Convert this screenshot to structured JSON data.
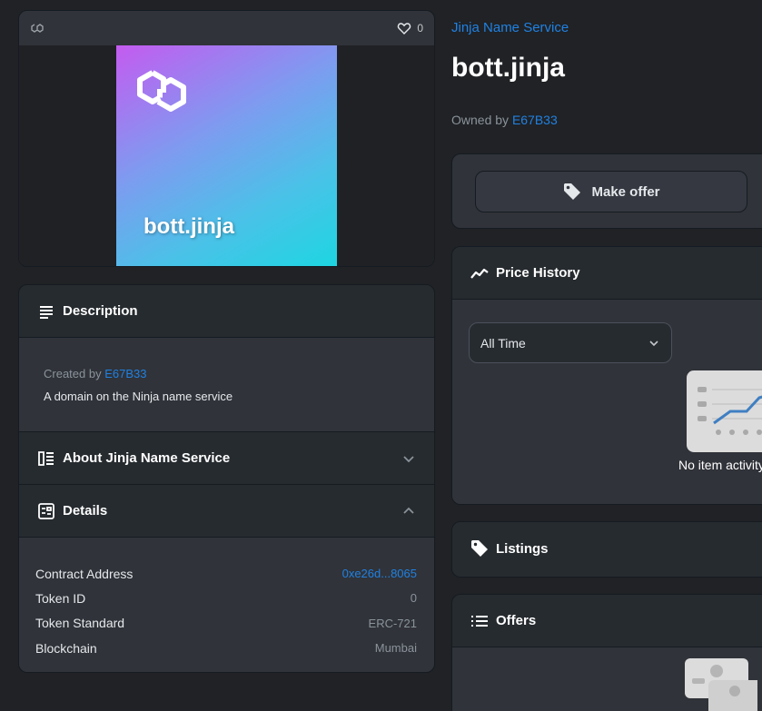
{
  "media": {
    "like_count": "0",
    "image_caption": "bott.jinja"
  },
  "description_panel": {
    "title": "Description",
    "created_by_prefix": "Created by",
    "creator": "E67B33",
    "text": "A domain on the Ninja name service"
  },
  "about_panel": {
    "title": "About Jinja Name Service"
  },
  "details_panel": {
    "title": "Details",
    "rows": [
      {
        "key": "Contract Address",
        "value": "0xe26d...8065"
      },
      {
        "key": "Token ID",
        "value": "0"
      },
      {
        "key": "Token Standard",
        "value": "ERC-721"
      },
      {
        "key": "Blockchain",
        "value": "Mumbai"
      }
    ]
  },
  "asset": {
    "collection": "Jinja Name Service",
    "title": "bott.jinja",
    "owned_by_prefix": "Owned by",
    "owner": "E67B33"
  },
  "offer": {
    "make_offer_label": "Make offer"
  },
  "price_history": {
    "title": "Price History",
    "range_selected": "All Time",
    "empty_text": "No item activity yet"
  },
  "listings": {
    "title": "Listings"
  },
  "offers": {
    "title": "Offers"
  },
  "colors": {
    "accent_link": "#2081e2",
    "background": "#202225",
    "panel": "#303339"
  }
}
